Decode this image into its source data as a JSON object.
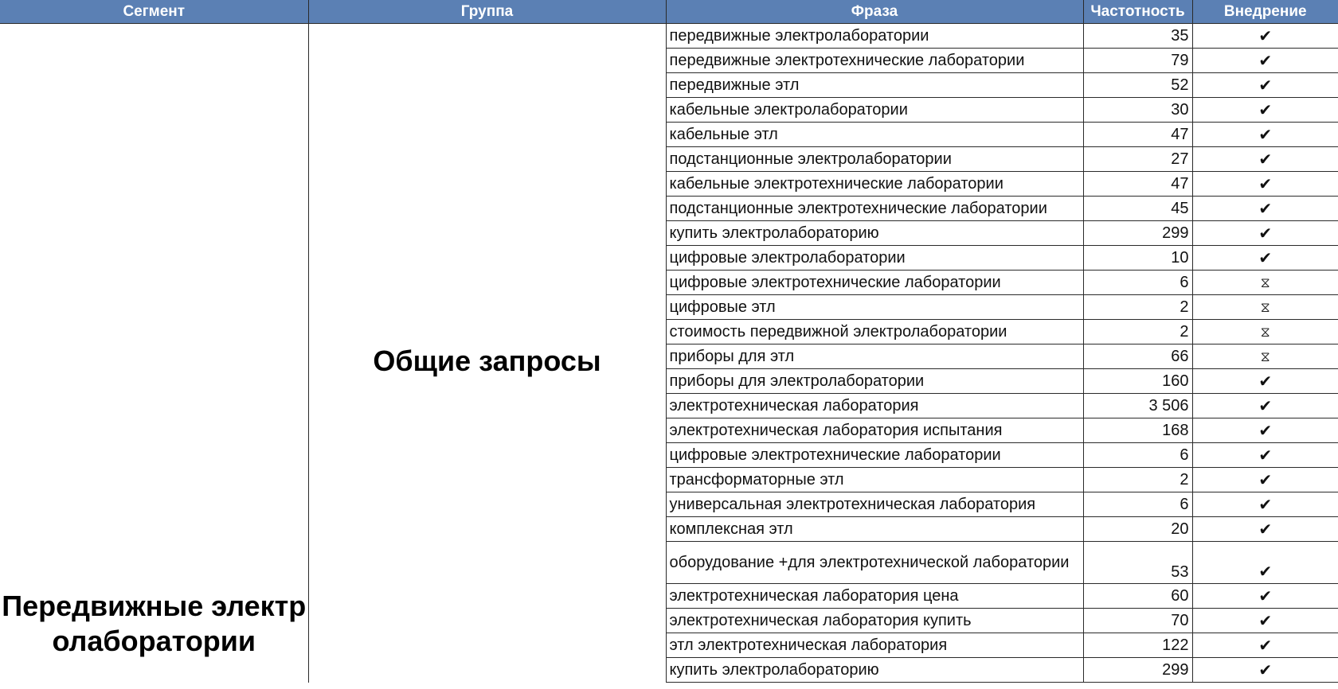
{
  "headers": {
    "segment": "Сегмент",
    "group": "Группа",
    "phrase": "Фраза",
    "frequency": "Частотность",
    "implementation": "Внедрение"
  },
  "segment": "Передвижные электролаборатории",
  "group": "Общие запросы",
  "marks": {
    "yes": "✔",
    "no": "⧖"
  },
  "rows": [
    {
      "phrase": "передвижные электролаборатории",
      "frequency": "35",
      "implemented": "✔"
    },
    {
      "phrase": "передвижные электротехнические лаборатории",
      "frequency": "79",
      "implemented": "✔"
    },
    {
      "phrase": "передвижные этл",
      "frequency": "52",
      "implemented": "✔"
    },
    {
      "phrase": "кабельные электролаборатории",
      "frequency": "30",
      "implemented": "✔"
    },
    {
      "phrase": "кабельные этл",
      "frequency": "47",
      "implemented": "✔"
    },
    {
      "phrase": "подстанционные электролаборатории",
      "frequency": "27",
      "implemented": "✔"
    },
    {
      "phrase": "кабельные электротехнические лаборатории",
      "frequency": "47",
      "implemented": "✔"
    },
    {
      "phrase": "подстанционные электротехнические лаборатории",
      "frequency": "45",
      "implemented": "✔"
    },
    {
      "phrase": "купить электролабораторию",
      "frequency": "299",
      "implemented": "✔"
    },
    {
      "phrase": "цифровые электролаборатории",
      "frequency": "10",
      "implemented": "✔"
    },
    {
      "phrase": "цифровые электротехнические лаборатории",
      "frequency": "6",
      "implemented": "⧖"
    },
    {
      "phrase": "цифровые этл",
      "frequency": "2",
      "implemented": "⧖"
    },
    {
      "phrase": "стоимость передвижной электролаборатории",
      "frequency": "2",
      "implemented": "⧖"
    },
    {
      "phrase": "приборы для этл",
      "frequency": "66",
      "implemented": "⧖"
    },
    {
      "phrase": "приборы для электролаборатории",
      "frequency": "160",
      "implemented": "✔"
    },
    {
      "phrase": "электротехническая лаборатория",
      "frequency": "3 506",
      "implemented": "✔"
    },
    {
      "phrase": "электротехническая лаборатория испытания",
      "frequency": "168",
      "implemented": "✔"
    },
    {
      "phrase": "цифровые электротехнические лаборатории",
      "frequency": "6",
      "implemented": "✔"
    },
    {
      "phrase": "трансформаторные этл",
      "frequency": "2",
      "implemented": "✔"
    },
    {
      "phrase": "универсальная электротехническая лаборатория",
      "frequency": "6",
      "implemented": "✔"
    },
    {
      "phrase": "комплексная этл",
      "frequency": "20",
      "implemented": "✔"
    },
    {
      "phrase": "оборудование +для электротехнической лаборатории",
      "frequency": "53",
      "implemented": "✔"
    },
    {
      "phrase": "электротехническая лаборатория цена",
      "frequency": "60",
      "implemented": "✔"
    },
    {
      "phrase": "электротехническая лаборатория купить",
      "frequency": "70",
      "implemented": "✔"
    },
    {
      "phrase": "этл электротехническая лаборатория",
      "frequency": "122",
      "implemented": "✔"
    },
    {
      "phrase": "купить электролабораторию",
      "frequency": "299",
      "implemented": "✔"
    }
  ],
  "colors": {
    "header_bg": "#5b80b4",
    "header_text": "#ffffff",
    "grid": "#2a2a2a"
  }
}
